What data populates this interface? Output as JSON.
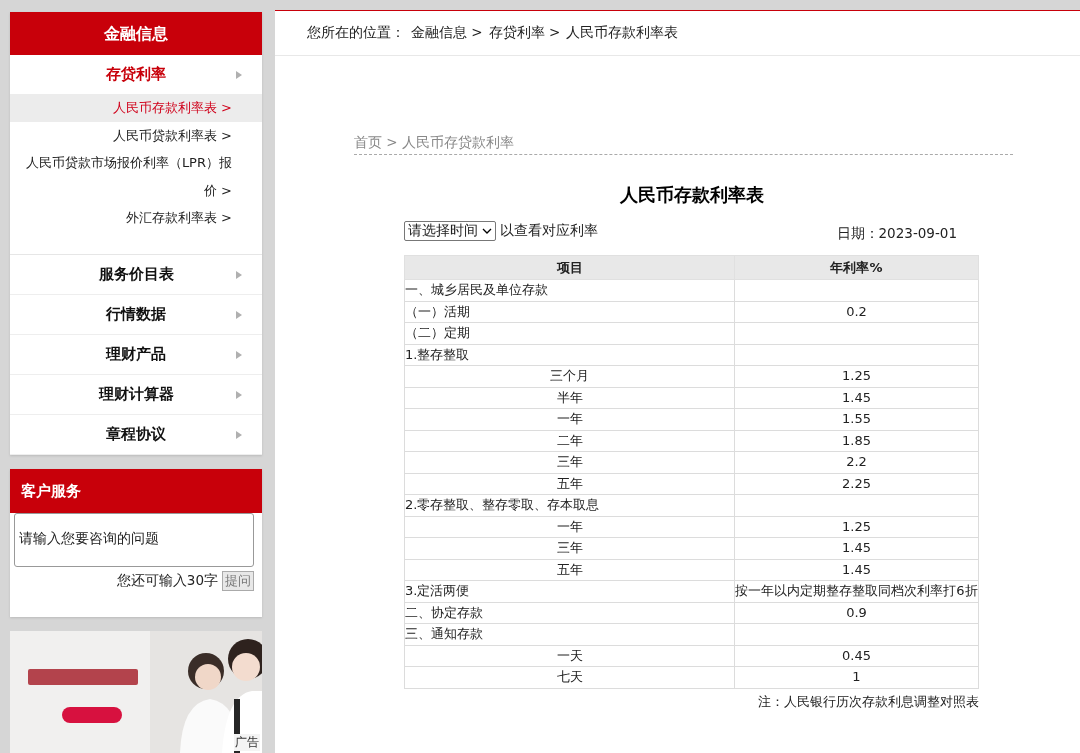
{
  "sidebar": {
    "title": "金融信息",
    "items": [
      {
        "label": "存贷利率",
        "selected": true,
        "expanded": true,
        "children": [
          {
            "label": "人民币存款利率表 >",
            "selected": true
          },
          {
            "label": "人民币贷款利率表 >",
            "selected": false
          },
          {
            "label": "人民币贷款市场报价利率（LPR）报价 >",
            "selected": false
          },
          {
            "label": "外汇存款利率表 >",
            "selected": false
          }
        ]
      },
      {
        "label": "服务价目表",
        "selected": false
      },
      {
        "label": "行情数据",
        "selected": false
      },
      {
        "label": "理财产品",
        "selected": false
      },
      {
        "label": "理财计算器",
        "selected": false
      },
      {
        "label": "章程协议",
        "selected": false
      }
    ]
  },
  "customer_service": {
    "title": "客户服务",
    "question": "请输入您要咨询的问题",
    "counter": "您还可输入30字",
    "button": "提问"
  },
  "ad": {
    "kind": "picture",
    "label": "广告"
  },
  "location": {
    "label": "您所在的位置：",
    "path": [
      "金融信息 >",
      "存贷利率 >",
      "人民币存款利率表"
    ]
  },
  "breadcrumb": "首页 > 人民币存贷款利率",
  "title": "人民币存款利率表",
  "period_select": {
    "value": "请选择时间",
    "hint": "以查看对应利率"
  },
  "date": "日期：2023-09-01",
  "table": {
    "columns": [
      "项目",
      "年利率%"
    ],
    "rows": [
      {
        "item": "一、城乡居民及单位存款",
        "kind": "heading"
      },
      {
        "item": "（一）活期",
        "kind": "heading",
        "rate": "0.2"
      },
      {
        "item": "（二）定期",
        "kind": "heading"
      },
      {
        "item": "1.整存整取",
        "kind": "heading"
      },
      {
        "item": "三个月",
        "kind": "term",
        "rate": "1.25"
      },
      {
        "item": "半年",
        "kind": "term",
        "rate": "1.45"
      },
      {
        "item": "一年",
        "kind": "term",
        "rate": "1.55"
      },
      {
        "item": "二年",
        "kind": "term",
        "rate": "1.85"
      },
      {
        "item": "三年",
        "kind": "term",
        "rate": "2.2"
      },
      {
        "item": "五年",
        "kind": "term",
        "rate": "2.25"
      },
      {
        "item": "2.零存整取、整存零取、存本取息",
        "kind": "heading"
      },
      {
        "item": "一年",
        "kind": "term",
        "rate": "1.25"
      },
      {
        "item": "三年",
        "kind": "term",
        "rate": "1.45"
      },
      {
        "item": "五年",
        "kind": "term",
        "rate": "1.45"
      },
      {
        "item": "3.定活两便",
        "kind": "heading",
        "rate": "按一年以内定期整存整取同档次利率打6折"
      },
      {
        "item": "二、协定存款",
        "kind": "heading",
        "rate": "0.9"
      },
      {
        "item": "三、通知存款",
        "kind": "heading"
      },
      {
        "item": "一天",
        "kind": "term",
        "rate": "0.45"
      },
      {
        "item": "七天",
        "kind": "term",
        "rate": "1"
      }
    ]
  },
  "note": "注：人民银行历次存款利息调整对照表"
}
